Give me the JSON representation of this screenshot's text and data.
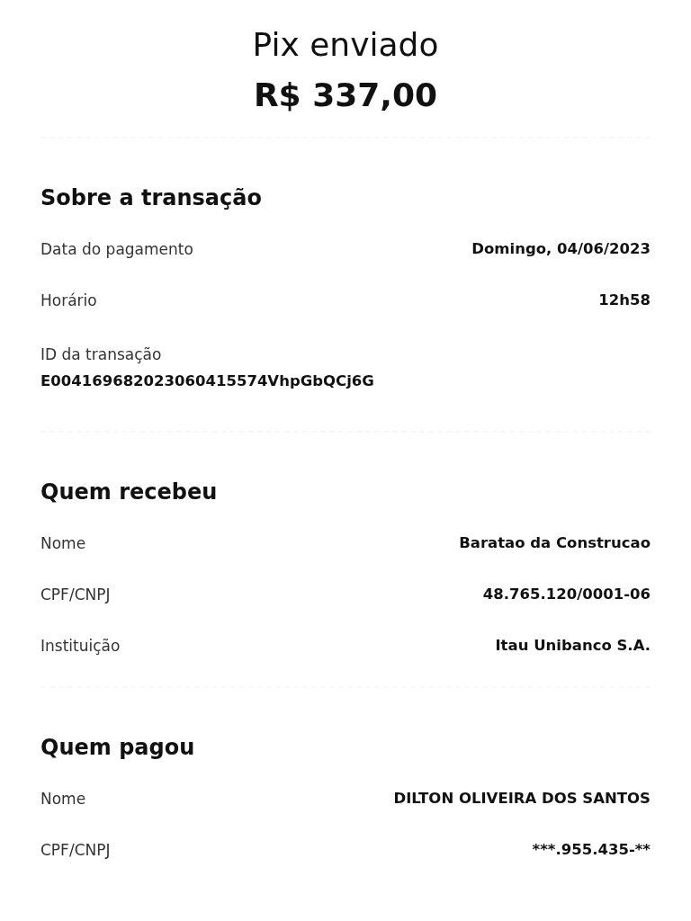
{
  "title": "Pix enviado",
  "amount": "R$ 337,00",
  "sections": [
    {
      "heading": "Sobre a transação",
      "rows": [
        {
          "kind": "inline",
          "label": "Data do pagamento",
          "value": "Domingo, 04/06/2023"
        },
        {
          "kind": "inline",
          "label": "Horário",
          "value": "12h58"
        },
        {
          "kind": "stacked",
          "label": "ID da transação",
          "value": "E00416968202306041557​4VhpGbQCj6G"
        }
      ]
    },
    {
      "heading": "Quem recebeu",
      "rows": [
        {
          "kind": "inline",
          "label": "Nome",
          "value": "Baratao da Construcao"
        },
        {
          "kind": "inline",
          "label": "CPF/CNPJ",
          "value": "48.765.120/0001-06"
        },
        {
          "kind": "inline",
          "label": "Instituição",
          "value": "Itau Unibanco S.A."
        }
      ]
    },
    {
      "heading": "Quem pagou",
      "rows": [
        {
          "kind": "inline",
          "label": "Nome",
          "value": "DILTON OLIVEIRA DOS SANTOS"
        },
        {
          "kind": "inline",
          "label": "CPF/CNPJ",
          "value": "***.955.435-**"
        }
      ]
    }
  ]
}
